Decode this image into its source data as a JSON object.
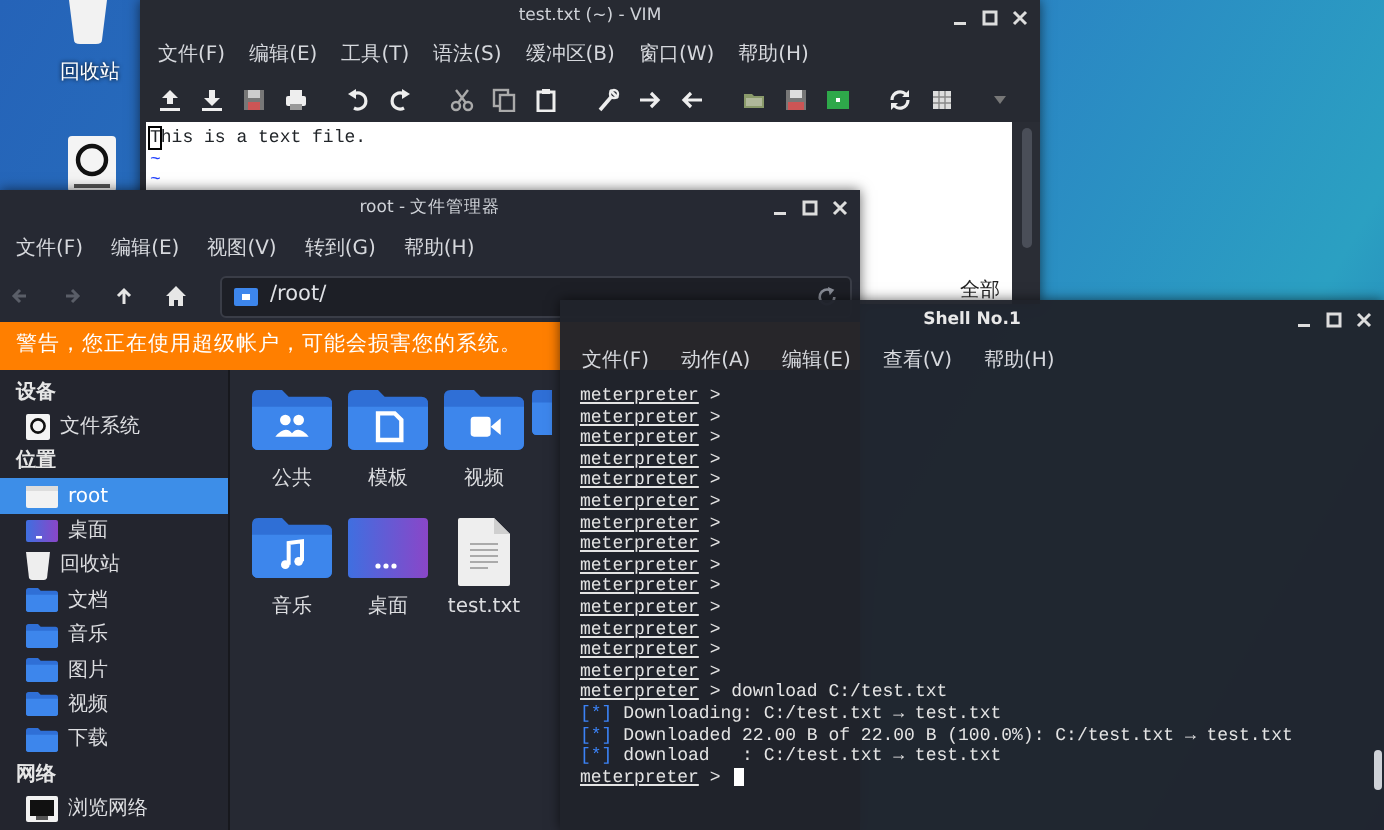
{
  "desktop": {
    "icons": [
      {
        "kind": "trash",
        "label": "回收站"
      },
      {
        "kind": "drive"
      }
    ]
  },
  "vim": {
    "title": "test.txt (~) - VIM",
    "menu": [
      "文件(F)",
      "编辑(E)",
      "工具(T)",
      "语法(S)",
      "缓冲区(B)",
      "窗口(W)",
      "帮助(H)"
    ],
    "lines": [
      {
        "text": "This is a text file.",
        "cursor": true
      }
    ],
    "tilde_lines": [
      "~",
      "~"
    ],
    "status": "全部"
  },
  "file_manager": {
    "title": "root - 文件管理器",
    "menu": [
      "文件(F)",
      "编辑(E)",
      "视图(V)",
      "转到(G)",
      "帮助(H)"
    ],
    "nav": [
      {
        "kind": "back",
        "disabled": true
      },
      {
        "kind": "forward",
        "disabled": true
      },
      {
        "kind": "up",
        "disabled": false
      },
      {
        "kind": "home",
        "disabled": false
      }
    ],
    "path": "/root/",
    "warning": "警告，您正在使用超级帐户，可能会损害您的系统。",
    "sidebar": [
      {
        "heading": "设备",
        "items": [
          {
            "label": "文件系统",
            "kind": "drive",
            "selected": false
          }
        ]
      },
      {
        "heading": "位置",
        "items": [
          {
            "label": "root",
            "kind": "home",
            "selected": true
          },
          {
            "label": "桌面",
            "kind": "desktop",
            "selected": false
          },
          {
            "label": "回收站",
            "kind": "trash",
            "selected": false
          },
          {
            "label": "文档",
            "kind": "folder",
            "selected": false
          },
          {
            "label": "音乐",
            "kind": "folder",
            "selected": false
          },
          {
            "label": "图片",
            "kind": "folder",
            "selected": false
          },
          {
            "label": "视频",
            "kind": "folder",
            "selected": false
          },
          {
            "label": "下载",
            "kind": "folder",
            "selected": false
          }
        ]
      },
      {
        "heading": "网络",
        "items": [
          {
            "label": "浏览网络",
            "kind": "network",
            "selected": false
          }
        ]
      }
    ],
    "files": [
      {
        "label": "公共",
        "kind": "folder"
      },
      {
        "label": "模板",
        "kind": "folder"
      },
      {
        "label": "视频",
        "kind": "folder"
      },
      {
        "kind": "folder"
      },
      {
        "label": "音乐",
        "kind": "folder"
      },
      {
        "label": "桌面",
        "kind": "desktop"
      },
      {
        "label": "test.txt",
        "kind": "document"
      }
    ]
  },
  "shell": {
    "title": "Shell No.1",
    "menu": [
      "文件(F)",
      "动作(A)",
      "编辑(E)",
      "查看(V)",
      "帮助(H)"
    ],
    "lines": [
      {
        "kind": "prompt",
        "prompt": "meterpreter",
        "sign": ">"
      },
      {
        "kind": "prompt",
        "prompt": "meterpreter",
        "sign": ">"
      },
      {
        "kind": "prompt",
        "prompt": "meterpreter",
        "sign": ">"
      },
      {
        "kind": "prompt",
        "prompt": "meterpreter",
        "sign": ">"
      },
      {
        "kind": "prompt",
        "prompt": "meterpreter",
        "sign": ">"
      },
      {
        "kind": "prompt",
        "prompt": "meterpreter",
        "sign": ">"
      },
      {
        "kind": "prompt",
        "prompt": "meterpreter",
        "sign": ">"
      },
      {
        "kind": "prompt",
        "prompt": "meterpreter",
        "sign": ">"
      },
      {
        "kind": "prompt",
        "prompt": "meterpreter",
        "sign": ">"
      },
      {
        "kind": "prompt",
        "prompt": "meterpreter",
        "sign": ">"
      },
      {
        "kind": "prompt",
        "prompt": "meterpreter",
        "sign": ">"
      },
      {
        "kind": "prompt",
        "prompt": "meterpreter",
        "sign": ">"
      },
      {
        "kind": "prompt",
        "prompt": "meterpreter",
        "sign": ">"
      },
      {
        "kind": "prompt",
        "prompt": "meterpreter",
        "sign": ">"
      },
      {
        "kind": "prompt",
        "prompt": "meterpreter",
        "sign": ">",
        "command": "download C:/test.txt"
      },
      {
        "kind": "info",
        "mark": "[*]",
        "text": "Downloading: C:/test.txt → test.txt"
      },
      {
        "kind": "info",
        "mark": "[*]",
        "text": "Downloaded 22.00 B of 22.00 B (100.0%): C:/test.txt → test.txt"
      },
      {
        "kind": "info",
        "mark": "[*]",
        "text": "download   : C:/test.txt → test.txt"
      },
      {
        "kind": "prompt",
        "prompt": "meterpreter",
        "sign": ">",
        "cursor": true
      }
    ]
  }
}
